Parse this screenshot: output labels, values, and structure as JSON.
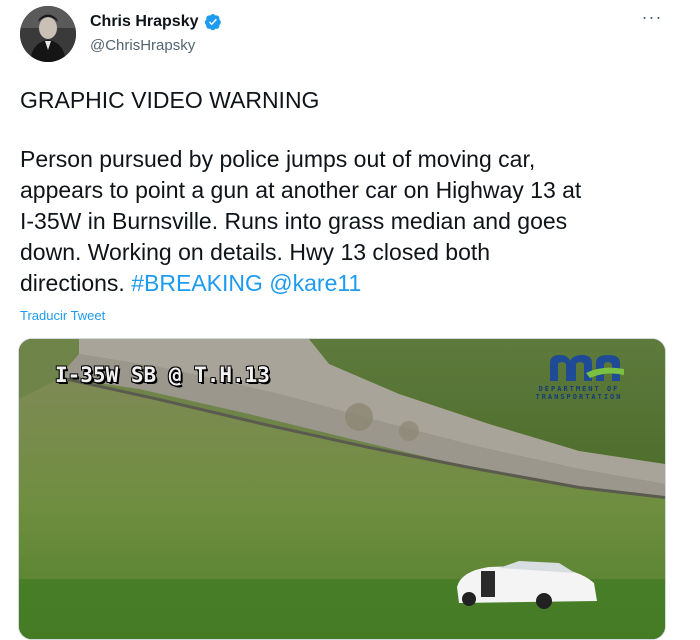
{
  "author": {
    "display_name": "Chris Hrapsky",
    "handle": "@ChrisHrapsky"
  },
  "more_menu": "···",
  "tweet": {
    "headline": "GRAPHIC VIDEO WARNING",
    "body_lines": [
      "Person pursued by police jumps out of moving car,",
      "appears to point a gun at another car on Highway 13 at",
      "I-35W in Burnsville. Runs into grass median and goes",
      "down. Working on details. Hwy 13 closed both",
      "directions."
    ],
    "hashtag": "#BREAKING",
    "mention": "@kare11",
    "translate_link": "Traducir Tweet"
  },
  "media": {
    "camera_label": "I-35W SB @ T.H.13",
    "logo_text": "mn",
    "department_line1": "DEPARTMENT OF",
    "department_line2": "TRANSPORTATION"
  },
  "colors": {
    "accent": "#1d9bf0",
    "text": "#0f1419",
    "secondary": "#536471"
  }
}
